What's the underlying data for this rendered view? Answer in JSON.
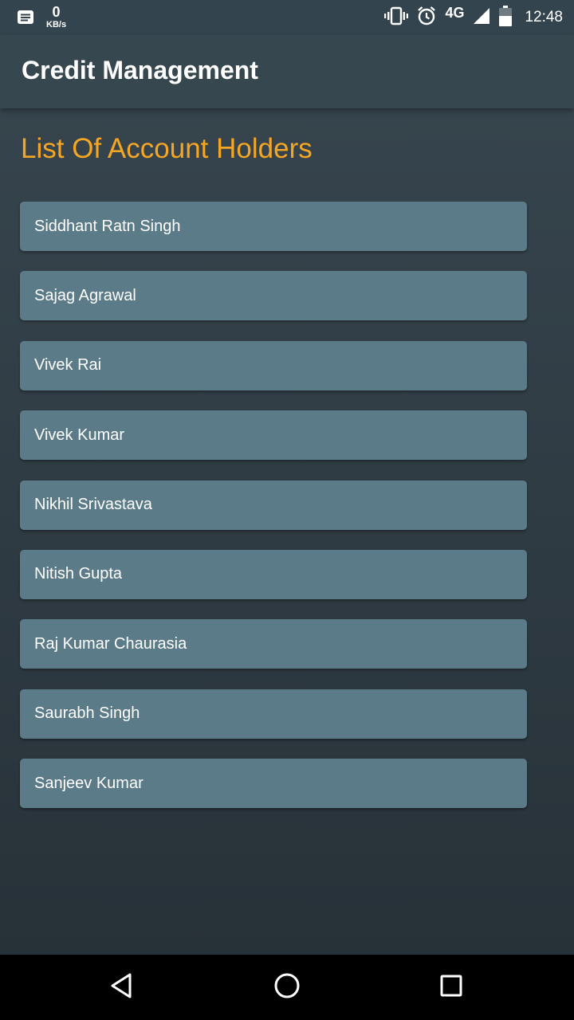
{
  "status_bar": {
    "net_speed_value": "0",
    "net_speed_unit": "KB/s",
    "network_type": "4G",
    "time": "12:48",
    "icons": [
      "message-icon",
      "vibrate-icon",
      "alarm-icon",
      "signal-icon",
      "battery-icon"
    ]
  },
  "app_bar": {
    "title": "Credit Management"
  },
  "main": {
    "section_title": "List Of Account Holders",
    "account_holders": [
      "Siddhant Ratn Singh",
      "Sajag Agrawal",
      "Vivek Rai",
      "Vivek Kumar",
      "Nikhil Srivastava",
      "Nitish Gupta",
      "Raj Kumar Chaurasia",
      "Saurabh Singh",
      "Sanjeev Kumar"
    ]
  },
  "nav_bar": {
    "icons": [
      "back-icon",
      "home-icon",
      "recents-icon"
    ]
  },
  "colors": {
    "accent": "#f5a623",
    "app_bar": "#37474f",
    "list_item": "#5c7b88",
    "background": "#2f3b44"
  }
}
